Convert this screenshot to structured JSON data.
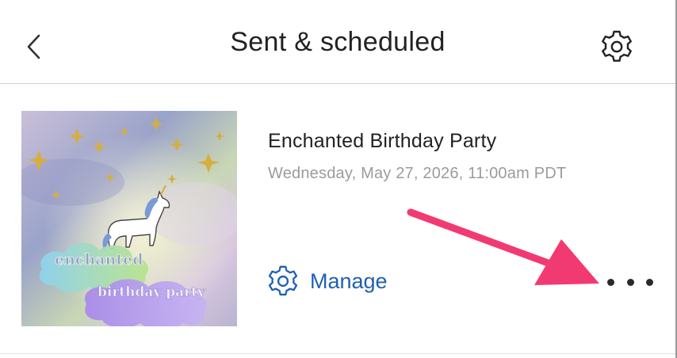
{
  "header": {
    "title": "Sent & scheduled",
    "back_icon": "chevron-left-icon",
    "settings_icon": "gear-icon"
  },
  "event": {
    "title": "Enchanted Birthday Party",
    "datetime": "Wednesday, May 27, 2026, 11:00am PDT",
    "thumbnail": {
      "line1": "enchanted",
      "line2": "birthday party"
    },
    "manage_label": "Manage",
    "manage_icon": "gear-icon",
    "more_icon": "more-horizontal-icon"
  },
  "colors": {
    "accent": "#1f5fb4",
    "annotation_arrow": "#f23a72",
    "title_text": "#222222",
    "secondary_text": "#9b9b9b"
  }
}
